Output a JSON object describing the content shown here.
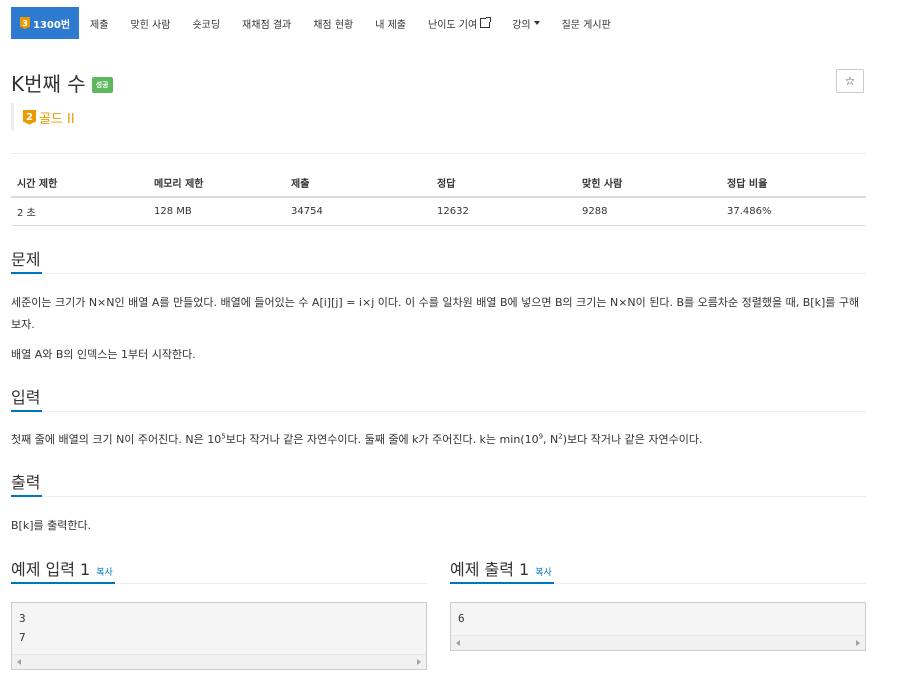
{
  "nav": {
    "active_badge": "3",
    "active_label": "1300번",
    "items": [
      "제출",
      "맞힌 사람",
      "숏코딩",
      "재채점 결과",
      "채점 현황",
      "내 제출",
      "난이도 기여",
      "강의",
      "질문 게시판"
    ]
  },
  "problem": {
    "title": "K번째 수",
    "status": "성공",
    "star": "☆",
    "tier_badge": "2",
    "tier": "골드 II"
  },
  "stats": {
    "headers": [
      "시간 제한",
      "메모리 제한",
      "제출",
      "정답",
      "맞힌 사람",
      "정답 비율"
    ],
    "values": [
      "2 초",
      "128 MB",
      "34754",
      "12632",
      "9288",
      "37.486%"
    ]
  },
  "sections": {
    "problem_heading": "문제",
    "problem_text_1": "세준이는 크기가 N×N인 배열 A를 만들었다. 배열에 들어있는 수 A[i][j] = i×j 이다. 이 수를 일차원 배열 B에 넣으면 B의 크기는 N×N이 된다. B를 오름차순 정렬했을 때, B[k]를 구해보자.",
    "problem_text_2": "배열 A와 B의 인덱스는 1부터 시작한다.",
    "input_heading": "입력",
    "input_text": {
      "p1": "첫째 줄에 배열의 크기 N이 주어진다. N은 10",
      "sup1": "5",
      "p2": "보다 작거나 같은 자연수이다. 둘째 줄에 k가 주어진다. k는 min(10",
      "sup2": "9",
      "p3": ", N",
      "sup3": "2",
      "p4": ")보다 작거나 같은 자연수이다."
    },
    "output_heading": "출력",
    "output_text": "B[k]를 출력한다.",
    "sample_input_heading": "예제 입력 1",
    "sample_output_heading": "예제 출력 1",
    "copy_label": "복사",
    "sample_input": "3\n7",
    "sample_output": "6"
  }
}
